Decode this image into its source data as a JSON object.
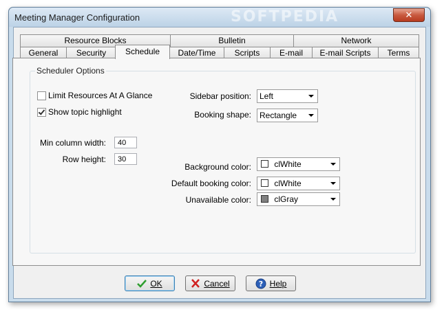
{
  "window": {
    "title": "Meeting Manager Configuration",
    "watermark": "SOFTPEDIA",
    "close_glyph": "✕"
  },
  "tabs": {
    "row1": [
      {
        "label": "Resource Blocks"
      },
      {
        "label": "Bulletin"
      },
      {
        "label": "Network"
      }
    ],
    "row2": [
      {
        "label": "General"
      },
      {
        "label": "Security"
      },
      {
        "label": "Schedule",
        "active": true
      },
      {
        "label": "Date/Time"
      },
      {
        "label": "Scripts"
      },
      {
        "label": "E-mail"
      },
      {
        "label": "E-mail Scripts"
      },
      {
        "label": "Terms"
      }
    ]
  },
  "scheduler": {
    "group_title": "Scheduler Options",
    "limit_resources": {
      "label": "Limit Resources At A Glance",
      "checked": false
    },
    "show_topic": {
      "label": "Show topic highlight",
      "checked": true
    },
    "min_column_width": {
      "label": "Min column width:",
      "value": "40"
    },
    "row_height": {
      "label": "Row height:",
      "value": "30"
    },
    "sidebar_position": {
      "label": "Sidebar position:",
      "value": "Left"
    },
    "booking_shape": {
      "label": "Booking shape:",
      "value": "Rectangle"
    },
    "background_color": {
      "label": "Background color:",
      "value": "clWhite",
      "swatch": "#ffffff"
    },
    "default_booking_color": {
      "label": "Default booking color:",
      "value": "clWhite",
      "swatch": "#ffffff"
    },
    "unavailable_color": {
      "label": "Unavailable color:",
      "value": "clGray",
      "swatch": "#808080"
    }
  },
  "buttons": {
    "ok": {
      "label": "OK",
      "icon": "check-icon",
      "color": "#2e9e2e"
    },
    "cancel": {
      "label": "Cancel",
      "icon": "x-icon",
      "color": "#d02020"
    },
    "help": {
      "label": "Help",
      "icon": "help-icon",
      "color": "#2c5fb8"
    }
  }
}
